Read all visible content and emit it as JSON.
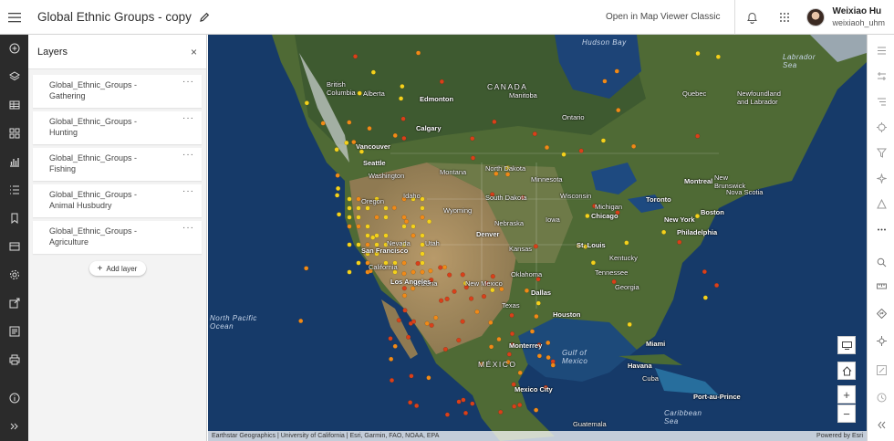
{
  "header": {
    "title": "Global Ethnic Groups - copy",
    "open_classic": "Open in Map Viewer Classic",
    "user_name": "Weixiao Hu",
    "user_id": "weixiaoh_uhm"
  },
  "layers_panel": {
    "title": "Layers",
    "close": "×",
    "items": [
      {
        "label": "Global_Ethnic_Groups - Gathering",
        "menu": "···"
      },
      {
        "label": "Global_Ethnic_Groups - Hunting",
        "menu": "···"
      },
      {
        "label": "Global_Ethnic_Groups - Fishing",
        "menu": "···"
      },
      {
        "label": "Global_Ethnic_Groups - Animal Husbudry",
        "menu": "···"
      },
      {
        "label": "Global_Ethnic_Groups - Agriculture",
        "menu": "···"
      }
    ],
    "add_layer": "Add layer"
  },
  "map": {
    "labels": {
      "canada": "CANADA",
      "mexico": "MÉXICO",
      "gulf_mexico": "Gulf of Mexico",
      "labrador_sea": "Labrador Sea",
      "hudson_bay": "Hudson Bay",
      "alberta": "Alberta",
      "british_columbia": "British Columbia",
      "manitoba": "Manitoba",
      "ontario": "Ontario",
      "quebec": "Quebec",
      "newfoundland": "Newfoundland and Labrador",
      "new_brunswick": "New Brunswick",
      "nova_scotia": "Nova Scotia",
      "edmonton": "Edmonton",
      "calgary": "Calgary",
      "vancouver": "Vancouver",
      "seattle": "Seattle",
      "washington": "Washington",
      "montana": "Montana",
      "oregon": "Oregon",
      "idaho": "Idaho",
      "wyoming": "Wyoming",
      "nevada": "Nevada",
      "utah": "Utah",
      "north_dakota": "North Dakota",
      "south_dakota": "South Dakota",
      "nebraska": "Nebraska",
      "kansas": "Kansas",
      "minnesota": "Minnesota",
      "wisconsin": "Wisconsin",
      "iowa": "Iowa",
      "michigan": "Michigan",
      "chicago": "Chicago",
      "toronto": "Toronto",
      "montreal": "Montreal",
      "boston": "Boston",
      "new_york": "New York",
      "philadelphia": "Philadelphia",
      "st_louis": "St. Louis",
      "kentucky": "Kentucky",
      "tennessee": "Tennessee",
      "georgia": "Georgia",
      "oklahoma": "Oklahoma",
      "new_mexico": "New Mexico",
      "arizona": "Arizona",
      "texas": "Texas",
      "dallas": "Dallas",
      "houston": "Houston",
      "denver": "Denver",
      "san_francisco": "San Francisco",
      "california": "California",
      "los_angeles": "Los Angeles",
      "monterrey": "Monterrey",
      "mexico_city": "Mexico City",
      "miami": "Miami",
      "havana": "Havana",
      "cuba": "Cuba",
      "guatemala": "Guatemala",
      "caribbean_sea": "Caribbean Sea",
      "port_au_prince": "Port-au-Prince",
      "north_pacific": "North Pacific Ocean",
      "attribution": "Earthstar Geographics | University of California | Esri, Garmin, FAO, NOAA, EPA",
      "powered_by": "Powered by Esri"
    },
    "controls": {
      "zoom_in": "+",
      "zoom_out": "−"
    }
  },
  "colors": {
    "toolbar_bg": "#2b2b2b",
    "ocean": "#1a3d6e",
    "land_green": "#4a6a2e",
    "land_desert": "#a58b5e",
    "dot_yellow": "#f4d11c",
    "dot_orange": "#f08a18",
    "dot_red": "#d9401a"
  }
}
